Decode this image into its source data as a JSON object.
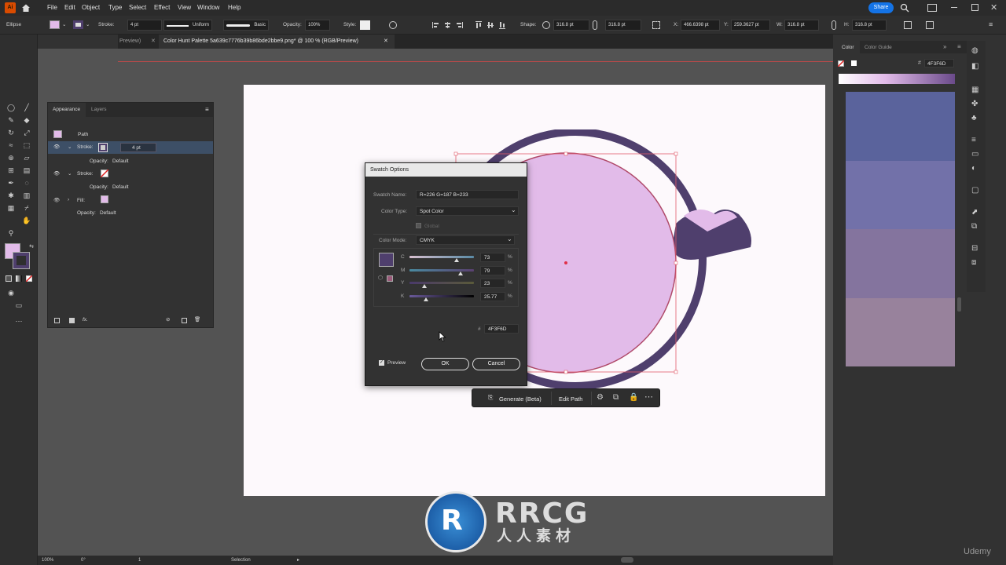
{
  "menubar": {
    "logo": "Ai",
    "items": [
      "File",
      "Edit",
      "Object",
      "Type",
      "Select",
      "Effect",
      "View",
      "Window",
      "Help"
    ],
    "share_label": "Share"
  },
  "control_bar": {
    "selection_type": "Ellipse",
    "stroke_label": "Stroke:",
    "stroke_weight": "4 pt",
    "profile_label": "Uniform",
    "brush_label": "Basic",
    "opacity_label": "Opacity:",
    "opacity_value": "100%",
    "style_label": "Style:",
    "shape_label": "Shape:",
    "shape_w": "316.8 pt",
    "shape_h": "316.8 pt",
    "x_label": "X:",
    "x_value": "466.6398 pt",
    "y_label": "Y:",
    "y_value": "259.3627 pt",
    "w_label": "W:",
    "w_value": "316.8 pt",
    "h_label": "H:",
    "h_value": "316.8 pt"
  },
  "tabs": {
    "prev_tab": "Preview)",
    "active_tab": "Color Hunt Palette 5a639c7776b39b86bde2bbe9.png* @ 100 % (RGB/Preview)"
  },
  "appearance": {
    "tab_appearance": "Appearance",
    "tab_layers": "Layers",
    "object": "Path",
    "stroke1_label": "Stroke:",
    "stroke1_weight": "4 pt",
    "opacity1": "Opacity:",
    "opacity1_value": "Default",
    "stroke2_label": "Stroke:",
    "opacity2": "Opacity:",
    "opacity2_value": "Default",
    "fill_label": "Fill:",
    "opacity3": "Opacity:",
    "opacity3_value": "Default",
    "fx_label": "fx."
  },
  "swatch_dialog": {
    "title": "Swatch Options",
    "name_label": "Swatch Name:",
    "name_value": "R=226 G=187 B=233",
    "type_label": "Color Type:",
    "type_value": "Spot Color",
    "global_label": "Global",
    "mode_label": "Color Mode:",
    "mode_value": "CMYK",
    "channels": [
      {
        "name": "C",
        "value": "73",
        "unit": "%",
        "level": 0.73
      },
      {
        "name": "M",
        "value": "79",
        "unit": "%",
        "level": 0.79
      },
      {
        "name": "Y",
        "value": "23",
        "unit": "%",
        "level": 0.23
      },
      {
        "name": "K",
        "value": "25.77",
        "unit": "%",
        "level": 0.2577
      }
    ],
    "hex_symbol": "#",
    "hex_value": "4F3F6D",
    "preview_label": "Preview",
    "ok_label": "OK",
    "cancel_label": "Cancel"
  },
  "context_bar": {
    "generate_label": "Generate (Beta)",
    "edit_path_label": "Edit Path"
  },
  "color_panel": {
    "tab_color": "Color",
    "tab_guide": "Color Guide",
    "hex_symbol": "#",
    "hex_value": "4F3F6D"
  },
  "status": {
    "zoom": "100%",
    "rotation": "0°",
    "artboard_num": "1",
    "tool": "Selection"
  },
  "watermark": {
    "brand": "RRCG",
    "sub": "人人素材",
    "udemy": "Udemy"
  },
  "colors": {
    "accent": "#4F3F6D",
    "fill": "#E2BBE9",
    "palette": [
      "#5A639C",
      "#7776B3",
      "#9B86BD",
      "#E2BBE9"
    ]
  }
}
